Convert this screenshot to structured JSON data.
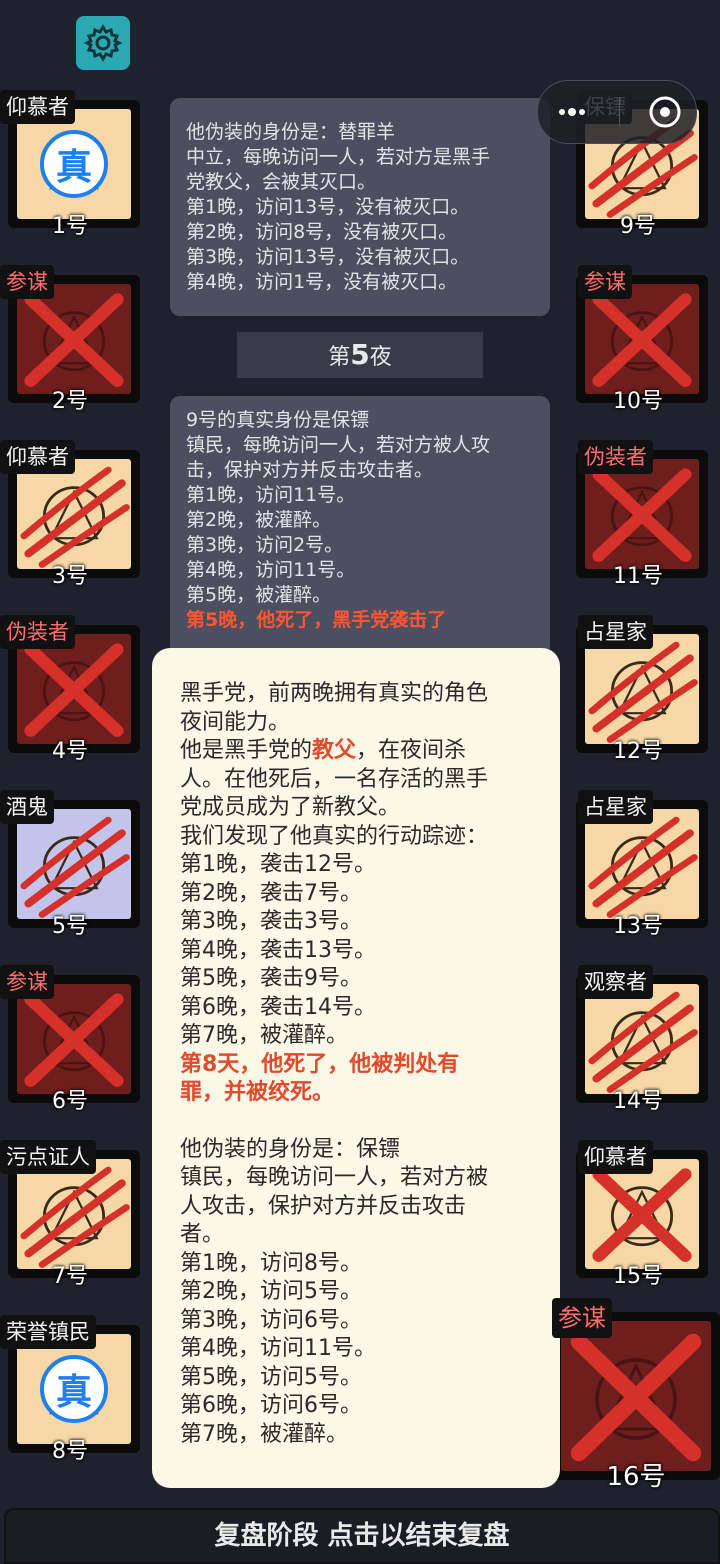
{
  "app": {
    "settings_icon": "gear-icon",
    "capsule_icons": [
      "more-dots-icon",
      "target-close-icon"
    ]
  },
  "colors": {
    "bg": "#1f222d",
    "tile_light": "#f5d8a6",
    "tile_dark": "#6e1f1d",
    "tile_lavender": "#c3c4ea",
    "slash_red": "#d6302a",
    "highlight": "#e14a2c",
    "badge_blue": "#1e7ff0"
  },
  "cards": [
    {
      "label": "仰慕者",
      "num": "1号",
      "status": "badge"
    },
    {
      "label": "参谋",
      "num": "2号",
      "status": "dead"
    },
    {
      "label": "仰慕者",
      "num": "3号",
      "status": "slashed"
    },
    {
      "label": "伪装者",
      "num": "4号",
      "status": "dead"
    },
    {
      "label": "酒鬼",
      "num": "5号",
      "status": "slashed"
    },
    {
      "label": "参谋",
      "num": "6号",
      "status": "dead"
    },
    {
      "label": "污点证人",
      "num": "7号",
      "status": "slashed"
    },
    {
      "label": "荣誉镇民",
      "num": "8号",
      "status": "badge"
    },
    {
      "label": "保镖",
      "num": "9号",
      "status": "slashed"
    },
    {
      "label": "参谋",
      "num": "10号",
      "status": "dead"
    },
    {
      "label": "伪装者",
      "num": "11号",
      "status": "dead"
    },
    {
      "label": "占星家",
      "num": "12号",
      "status": "slashed"
    },
    {
      "label": "占星家",
      "num": "13号",
      "status": "slashed"
    },
    {
      "label": "观察者",
      "num": "14号",
      "status": "slashed"
    },
    {
      "label": "仰慕者",
      "num": "15号",
      "status": "crossed"
    },
    {
      "label": "参谋",
      "num": "16号",
      "status": "dead"
    }
  ],
  "badge_text": "真",
  "log": {
    "panel1": [
      "他伪装的身份是：替罪羊",
      "中立，每晚访问一人，若对方是黑手",
      "党教父，会被其灭口。",
      "第1晚，访问13号，没有被灭口。",
      "第2晚，访问8号，没有被灭口。",
      "第3晚，访问13号，没有被灭口。",
      "第4晚，访问1号，没有被灭口。"
    ],
    "night_prefix": "第",
    "night_num": "5",
    "night_suffix": "夜",
    "panel2": [
      "9号的真实身份是保镖",
      "镇民，每晚访问一人，若对方被人攻",
      "击，保护对方并反击攻击者。",
      "第1晚，访问11号。",
      "第2晚，被灌醉。",
      "第3晚，访问2号。",
      "第4晚，访问11号。",
      "第5晚，被灌醉。"
    ],
    "panel2_red": "第5晚，他死了，黑手党袭击了"
  },
  "popup": {
    "l1": "黑手党，前两晚拥有真实的角色",
    "l2": "夜间能力。",
    "l3a": "他是黑手党的",
    "l3b": "教父",
    "l3c": "，在夜间杀",
    "l4": "人。在他死后，一名存活的黑手",
    "l5": "党成员成为了新教父。",
    "l6": "我们发现了他真实的行动踪迹：",
    "actions": [
      "第1晚，袭击12号。",
      "第2晚，袭击7号。",
      "第3晚，袭击3号。",
      "第4晚，袭击13号。",
      "第5晚，袭击9号。",
      "第6晚，袭击14号。",
      "第7晚，被灌醉。"
    ],
    "death1": "第8天，他死了，他被判处有",
    "death2": "罪，并被绞死。",
    "d1": "他伪装的身份是：保镖",
    "d2": "镇民，每晚访问一人，若对方被",
    "d3": "人攻击，保护对方并反击攻击",
    "d4": "者。",
    "visits": [
      "第1晚，访问8号。",
      "第2晚，访问5号。",
      "第3晚，访问6号。",
      "第4晚，访问11号。",
      "第5晚，访问5号。",
      "第6晚，访问6号。",
      "第7晚，被灌醉。"
    ]
  },
  "bottom_bar": "复盘阶段 点击以结束复盘"
}
